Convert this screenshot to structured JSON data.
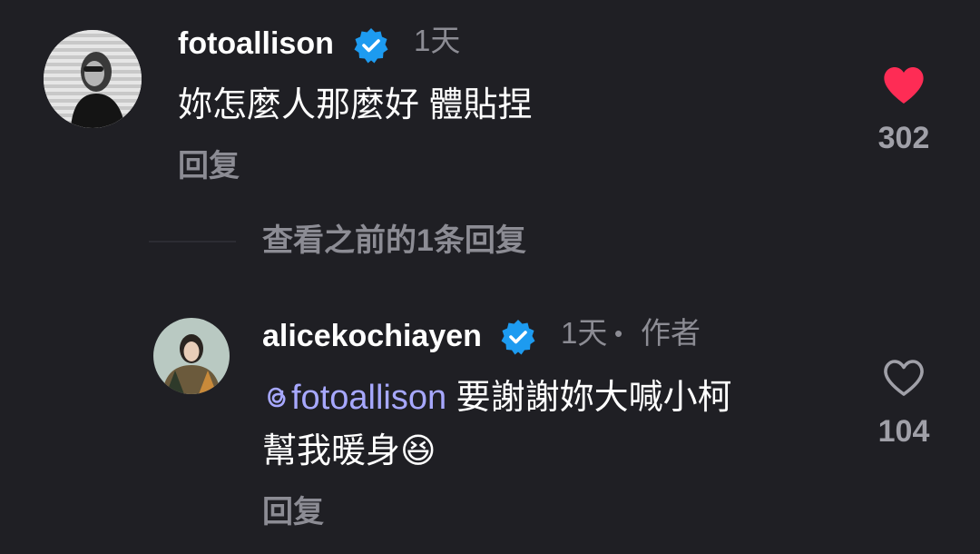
{
  "comments": [
    {
      "username": "fotoallison",
      "time": "1天",
      "text": "妳怎麼人那麼好 體貼捏",
      "reply_label": "回复",
      "like_count": "302",
      "liked": true
    }
  ],
  "view_replies_label": "查看之前的1条回复",
  "reply": {
    "username": "alicekochiayen",
    "time": "1天",
    "separator": "•",
    "author_badge": "作者",
    "mention": "fotoallison",
    "text_line1": " 要謝謝妳大喊小柯",
    "text_line2": "幫我暖身😆",
    "reply_label": "回复",
    "like_count": "104",
    "liked": false
  },
  "colors": {
    "background": "#1f1f24",
    "liked_heart": "#fe2c55",
    "verified": "#1d9bf0",
    "mention": "#a7a8ff",
    "muted_text": "#8c8c94"
  },
  "icons": {
    "verified": "verified-badge-icon",
    "heart_filled": "heart-filled-icon",
    "heart_outline": "heart-outline-icon",
    "threads": "threads-mention-icon"
  }
}
